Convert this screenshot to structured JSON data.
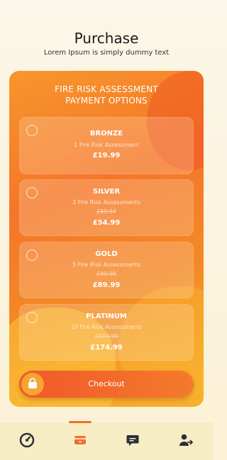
{
  "header": {
    "title": "Purchase",
    "subtitle": "Lorem Ipsum is simply dummy text"
  },
  "panel": {
    "title_line1": "FIRE RISK ASSESSMENT",
    "title_line2": "PAYMENT OPTIONS"
  },
  "plans": [
    {
      "name": "BRONZE",
      "description": "1 Fire Risk Assessment",
      "original_price": "",
      "price": "£19.99"
    },
    {
      "name": "SILVER",
      "description": "3 Fire Risk Assessments",
      "original_price": "£59.97",
      "price": "£54.99"
    },
    {
      "name": "GOLD",
      "description": "5 Fire Risk Assessments",
      "original_price": "£99.95",
      "price": "£89.99"
    },
    {
      "name": "PLATINUM",
      "description": "10 Fire Risk Assessments",
      "original_price": "£199.90",
      "price": "£174.99"
    }
  ],
  "checkout": {
    "label": "Checkout",
    "icon": "shopping-bag-icon"
  },
  "nav": {
    "active_index": 1,
    "items": [
      {
        "icon": "speedometer-icon"
      },
      {
        "icon": "payment-card-icon"
      },
      {
        "icon": "chat-icon"
      },
      {
        "icon": "user-logout-icon"
      }
    ]
  },
  "colors": {
    "accent": "#f36d2a",
    "panel_orange": "#f5762a",
    "nav_background": "#f7edc4",
    "icon_dark": "#2a2f3a"
  }
}
